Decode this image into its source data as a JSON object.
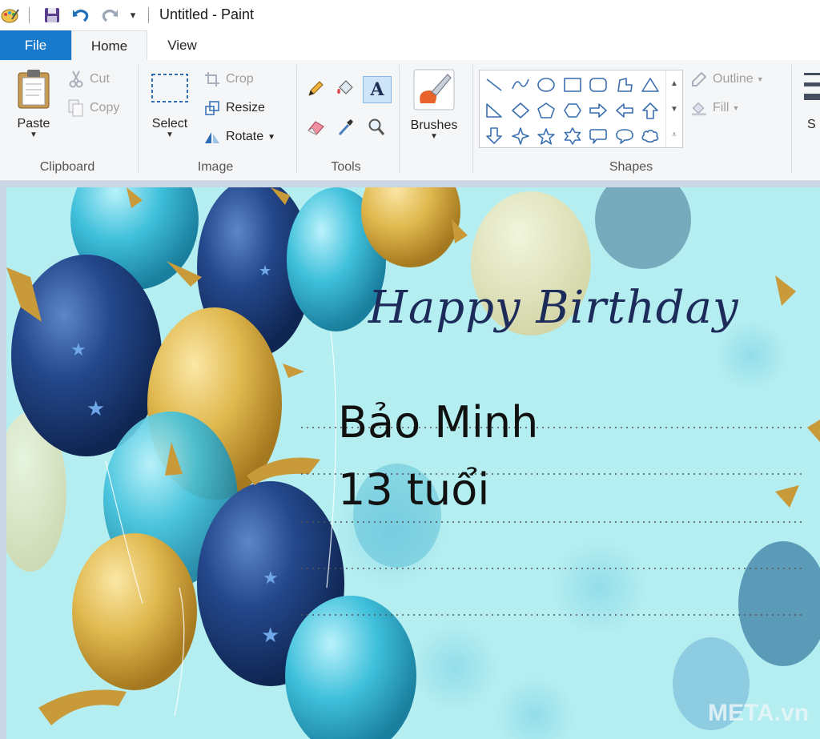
{
  "window": {
    "title": "Untitled - Paint"
  },
  "quick_access": {
    "items": [
      {
        "icon": "paint-app-icon"
      },
      {
        "icon": "save-icon"
      },
      {
        "icon": "undo-icon"
      },
      {
        "icon": "redo-icon"
      },
      {
        "icon": "customize-dropdown-icon"
      }
    ]
  },
  "tabs": [
    {
      "label": "File",
      "active": false
    },
    {
      "label": "Home",
      "active": true
    },
    {
      "label": "View",
      "active": false
    }
  ],
  "ribbon": {
    "clipboard": {
      "group_label": "Clipboard",
      "paste_label": "Paste",
      "cut_label": "Cut",
      "copy_label": "Copy"
    },
    "image": {
      "group_label": "Image",
      "select_label": "Select",
      "crop_label": "Crop",
      "resize_label": "Resize",
      "rotate_label": "Rotate"
    },
    "tools": {
      "group_label": "Tools",
      "items": [
        "pencil-icon",
        "fill-bucket-icon",
        "text-icon",
        "eraser-icon",
        "color-picker-icon",
        "magnifier-icon"
      ],
      "selected": "text-icon"
    },
    "brushes": {
      "label": "Brushes"
    },
    "shapes": {
      "group_label": "Shapes",
      "items": [
        "line",
        "curve",
        "oval",
        "rectangle",
        "rounded-rectangle",
        "polygon",
        "triangle",
        "right-triangle",
        "diamond",
        "pentagon",
        "hexagon",
        "right-arrow",
        "left-arrow",
        "up-arrow",
        "down-arrow",
        "four-point-star",
        "five-point-star",
        "six-point-star",
        "rounded-callout",
        "oval-callout",
        "cloud-callout"
      ],
      "outline_label": "Outline",
      "fill_label": "Fill"
    },
    "size_label": "S"
  },
  "canvas": {
    "heading": "Happy Birthday",
    "name_line": "Bảo Minh",
    "age_line": "13 tuổi",
    "watermark": "META.vn"
  },
  "colors": {
    "file_tab": "#1979ca",
    "ribbon_bg": "#f5f6f7",
    "canvas_bg": "#b6eef0",
    "heading_color": "#1d2b5a",
    "balloon_navy": "#1f3f7e",
    "balloon_gold": "#e0b84e",
    "balloon_cyan": "#3fc0db"
  }
}
